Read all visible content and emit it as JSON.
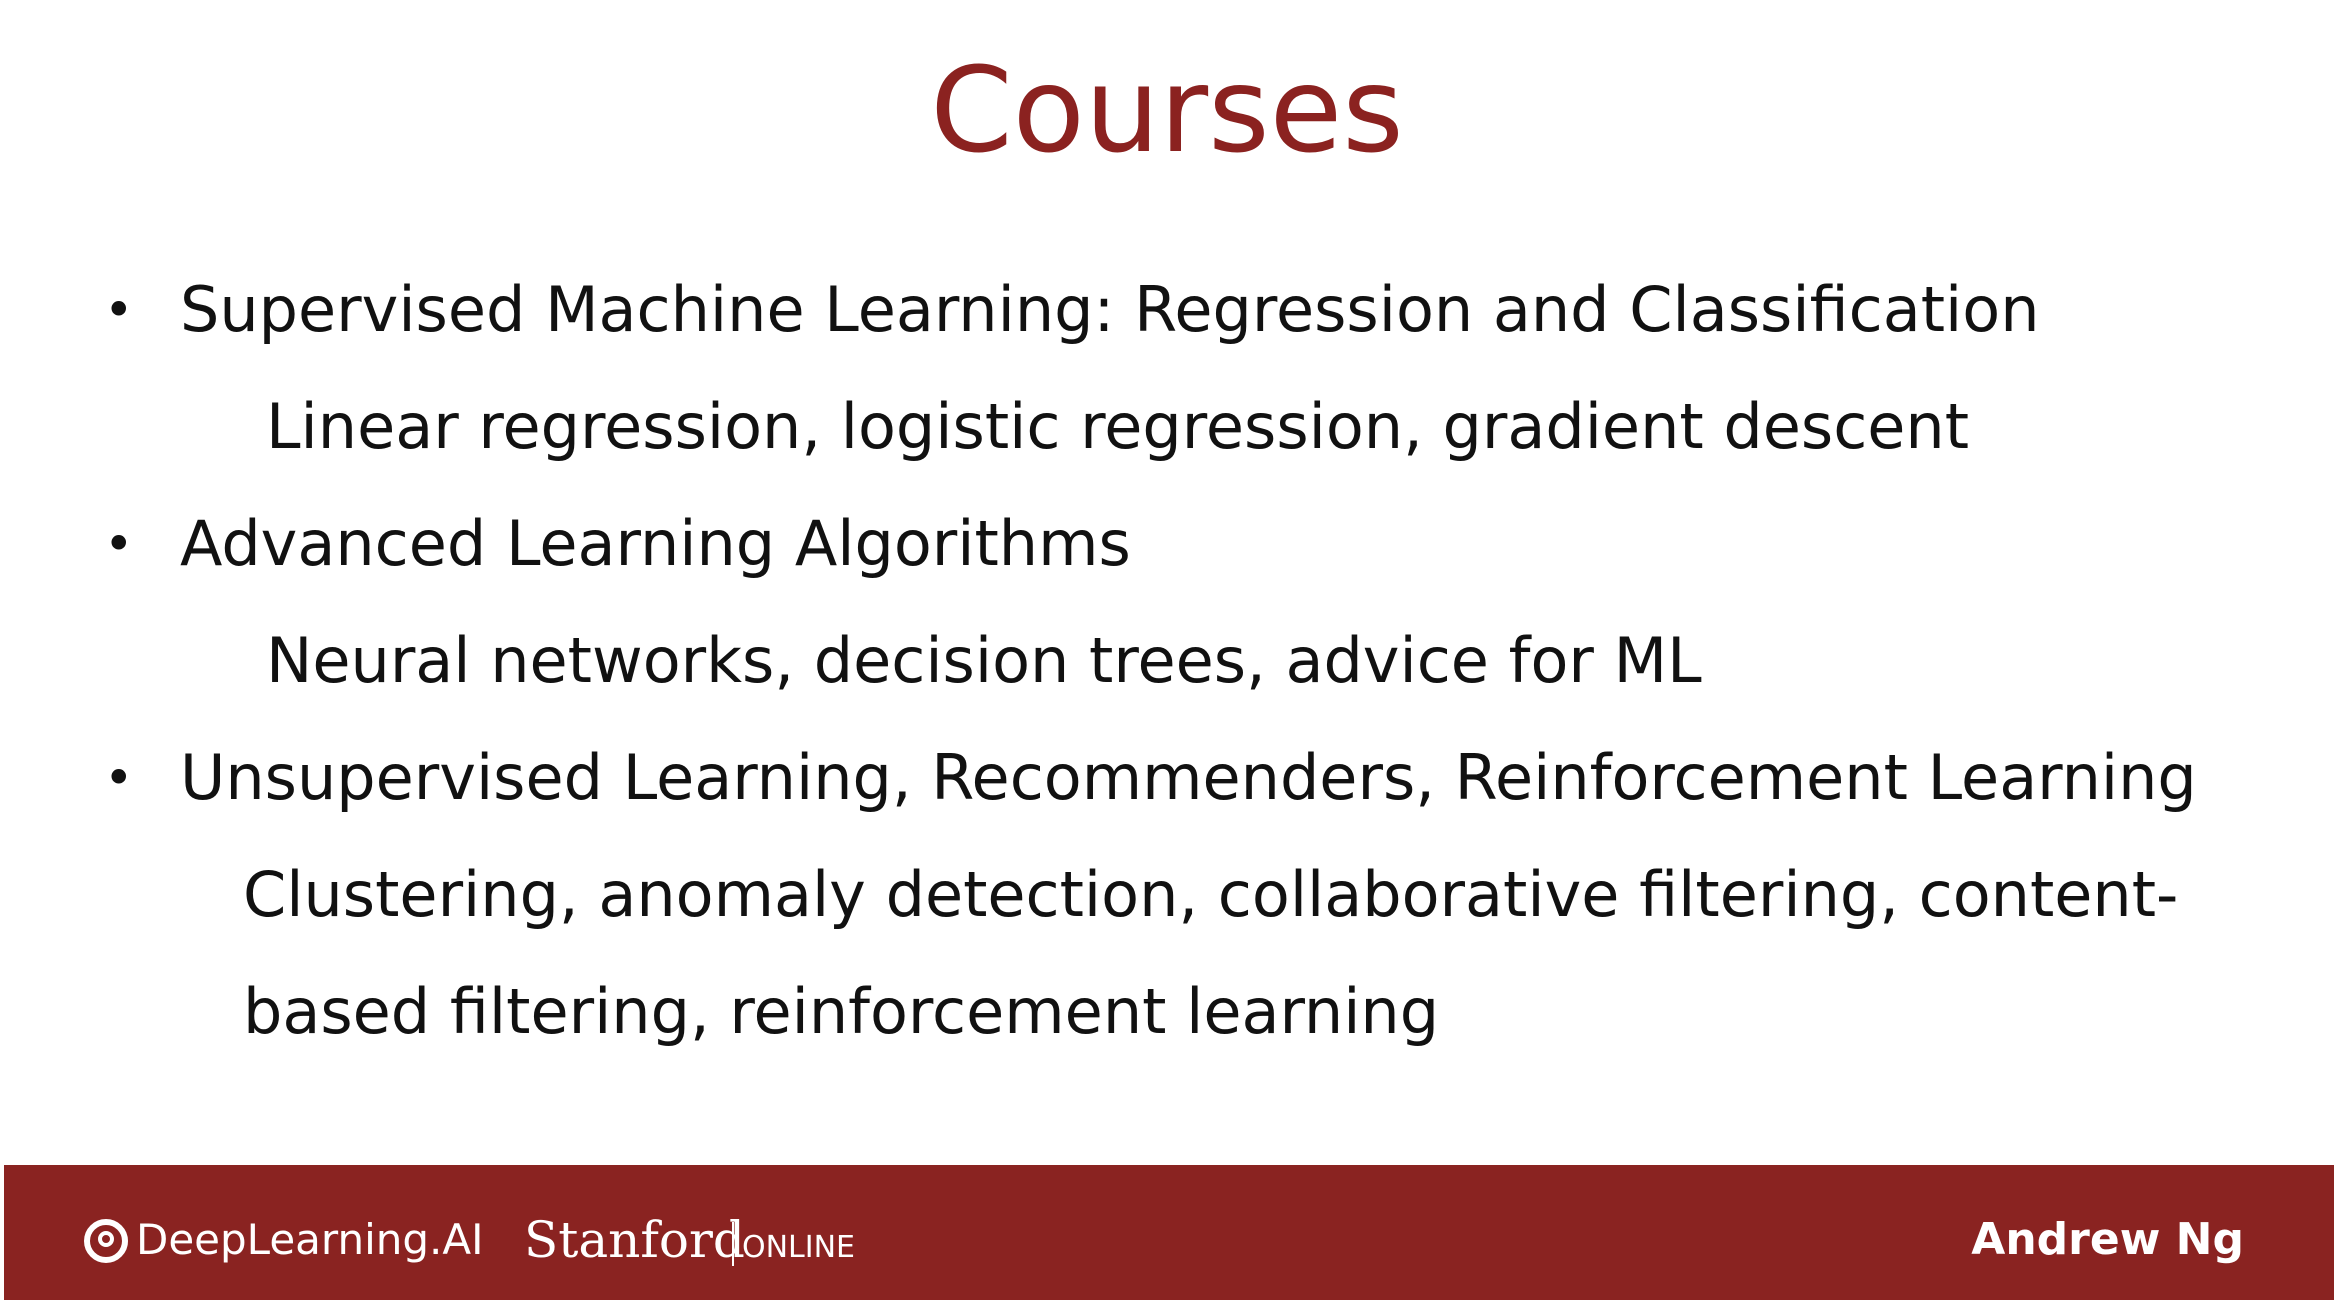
{
  "slide": {
    "title": "Courses",
    "courses": [
      {
        "name": "Supervised Machine Learning: Regression and Classification",
        "topics": [
          "Linear regression, logistic regression, gradient descent"
        ]
      },
      {
        "name": "Advanced Learning Algorithms",
        "topics": [
          "Neural networks, decision trees, advice for ML"
        ]
      },
      {
        "name": "Unsupervised Learning, Recommenders, Reinforcement Learning",
        "topics": [
          "Clustering, anomaly detection, collaborative filtering, content-",
          "based filtering, reinforcement learning"
        ]
      }
    ]
  },
  "footer": {
    "deeplearning_logo_text": "DeepLearning.AI",
    "stanford_text": "Stanford",
    "online_text": "ONLINE",
    "author": "Andrew Ng",
    "background_color": "#8a2321"
  },
  "colors": {
    "title": "#8b2220",
    "text": "#111111"
  }
}
